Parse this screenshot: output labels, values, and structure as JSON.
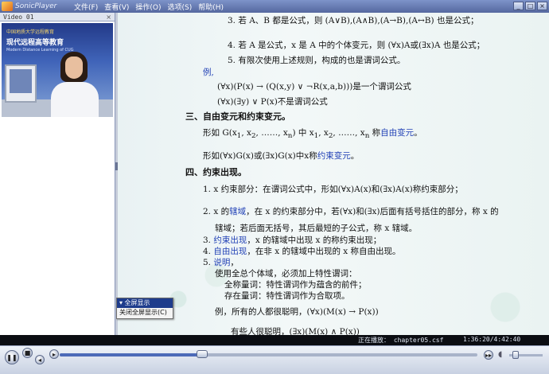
{
  "app": {
    "name": "SonicPlayer",
    "menu": [
      "文件(F)",
      "查看(V)",
      "操作(O)",
      "选项(S)",
      "帮助(H)"
    ],
    "window_buttons": [
      "_",
      "□",
      "×"
    ]
  },
  "video_panel": {
    "title": "Video 01",
    "close": "×",
    "banner_line1": "中国地质大学远程教育",
    "banner_line2": "现代远程高等教育",
    "banner_line3": "Modern Distance Learning of CUG"
  },
  "content": {
    "l1": "3. 若 A、B 都是公式，则 (A∨B),(A∧B),(A→B),(A↔B) 也是公式；",
    "l2": "4. 若 A 是公式，x 是 A 中的个体变元，则 (∀x)A或(∃x)A 也是公式；",
    "l3": "5. 有限次使用上述规则，构成的也是谓词公式。",
    "l4": "例,",
    "l5": "(∀x)(P(x) → (Q(x,y) ∨ ¬R(x,a,b)))是一个谓词公式",
    "l6": "(∀x)(∃y) ∨ P(x)不是谓词公式",
    "l7": "三、自由变元和约束变元。",
    "l8a": "形如 G(x",
    "l8b": "1",
    "l8c": ", x",
    "l8d": "2",
    "l8e": ", ……, x",
    "l8f": "n",
    "l8g": ") 中 x",
    "l8h": "1",
    "l8i": ", x",
    "l8j": "2",
    "l8k": ", ……, x",
    "l8l": "n",
    "l8m": " 称",
    "l8n": "自由变元",
    "l8o": "。",
    "l9a": "形如(∀x)G(x)或(∃x)G(x)中x称",
    "l9b": "约束变元",
    "l9c": "。",
    "l10": "四、约束出现。",
    "l11": "1. x 约束部分：在谓词公式中，形如(∀x)A(x)和(∃x)A(x)称约束部分；",
    "l12a": "2. x 的",
    "l12b": "辖域",
    "l12c": "，在 x 的约束部分中，若(∀x)和(∃x)后面有括号括住的部分，称 x 的",
    "l13": "辖域；若后面无括号，其后最短的子公式，称 x 辖域。",
    "l14a": "3. ",
    "l14b": "约束出现",
    "l14c": "，x 的辖域中出现 x 的称约束出现；",
    "l15a": "4. ",
    "l15b": "自由出现",
    "l15c": "，在非 x 的辖域中出现的 x 称自由出现。",
    "l16a": "5. ",
    "l16b": "说明",
    "l16c": "，",
    "l17": "使用全总个体域，必须加上特性谓词：",
    "l18": "全称量词：特性谓词作为蕴含的前件；",
    "l19": "存在量词：特性谓词作为合取项。",
    "l20": "例，所有的人都很聪明，(∀x)(M(x) → P(x))",
    "l21": "有些人很聪明，(∃x)(M(x) ∧ P(x))"
  },
  "context_menu": {
    "item1": "▾ 全屏显示",
    "item2": "关闭全屏显示(C)"
  },
  "status": {
    "playing": "正在播放： chapter05.csf",
    "time": "1:36:20/4:42:40"
  },
  "controls": {
    "play_pause": "❚❚",
    "stop": "■",
    "prev": "◂",
    "next": "▸",
    "speed": "▸▸",
    "progress_fraction": 0.34,
    "volume_fraction": 0.2,
    "volume_icon": "speaker-icon",
    "accent_color": "#1f3fb5"
  }
}
